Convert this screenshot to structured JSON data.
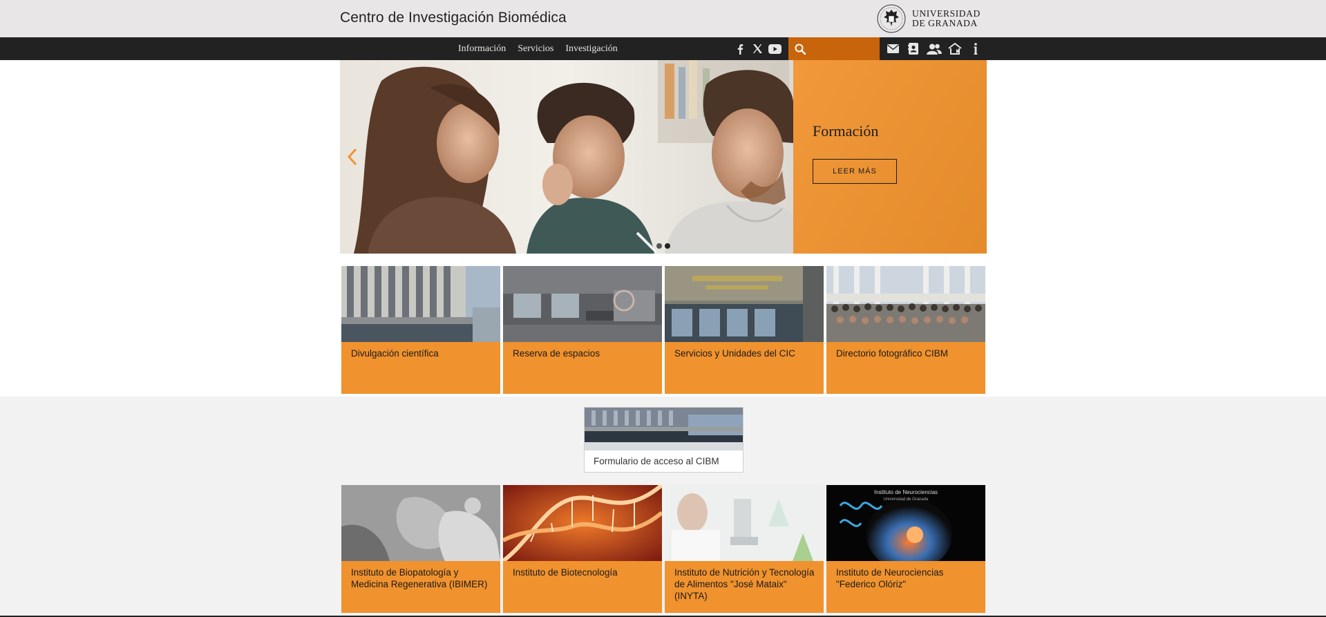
{
  "header": {
    "site_title": "Centro de Investigación Biomédica",
    "university_line1": "UNIVERSIDAD",
    "university_line2": "DE GRANADA"
  },
  "nav": {
    "links": [
      "Información",
      "Servicios",
      "Investigación"
    ],
    "social_icons": [
      "facebook-icon",
      "x-twitter-icon",
      "youtube-icon"
    ],
    "search_placeholder": "",
    "utility_icons": [
      "mail-icon",
      "contact-card-icon",
      "users-icon",
      "home-icon",
      "info-icon"
    ]
  },
  "hero": {
    "title": "Formación",
    "button_label": "LEER MÁS",
    "slides": 2,
    "active_slide": 1
  },
  "cards_top": [
    {
      "label": "Divulgación científica"
    },
    {
      "label": "Reserva de espacios"
    },
    {
      "label": "Servicios y Unidades del CIC"
    },
    {
      "label": "Directorio fotográfico CIBM"
    }
  ],
  "access_card": {
    "label": "Formulario de acceso al CIBM"
  },
  "cards_bottom": [
    {
      "label": "Instituto de Biopatología y Medicina Regenerativa (IBIMER)"
    },
    {
      "label": "Instituto de Biotecnología"
    },
    {
      "label": "Instituto de Nutrición y Tecnología de Alimentos \"José Mataix\" (INYTA)"
    },
    {
      "label": "Instituto de Neurociencias \"Federico Olóriz\""
    }
  ],
  "card4_inner": {
    "line1": "Instituto de Neurociencias",
    "line2": "Universidad de Granada"
  },
  "colors": {
    "accent_orange": "#f0922e",
    "search_orange": "#c8650c",
    "nav_dark": "#222222",
    "header_grey": "#e9e6e7",
    "band_grey": "#f2f2f2"
  }
}
